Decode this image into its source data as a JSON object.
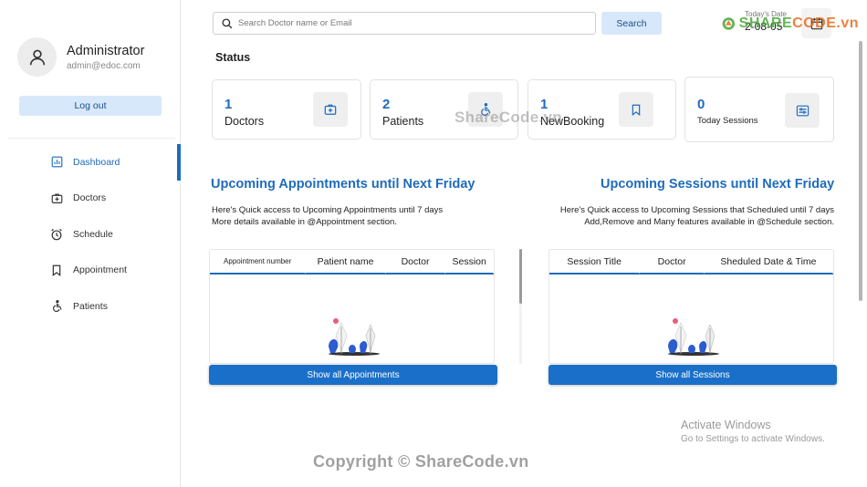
{
  "sidebar": {
    "admin_name": "Administrator",
    "admin_email": "admin@edoc.com",
    "logout_label": "Log out",
    "items": [
      {
        "label": "Dashboard",
        "icon": "dashboard-icon",
        "active": true
      },
      {
        "label": "Doctors",
        "icon": "doctor-icon",
        "active": false
      },
      {
        "label": "Schedule",
        "icon": "alarm-clock-icon",
        "active": false
      },
      {
        "label": "Appointment",
        "icon": "bookmark-icon",
        "active": false
      },
      {
        "label": "Patients",
        "icon": "wheelchair-icon",
        "active": false
      }
    ]
  },
  "header": {
    "search_placeholder": "Search Doctor name or Email",
    "search_button": "Search",
    "today_label": "Today's Date",
    "today_value": "2-08-05"
  },
  "status": {
    "title": "Status",
    "cards": [
      {
        "count": "1",
        "label": "Doctors",
        "icon": "doctor-icon"
      },
      {
        "count": "2",
        "label": "Patients",
        "icon": "wheelchair-icon"
      },
      {
        "count": "1",
        "label": "NewBooking",
        "icon": "bookmark-icon"
      },
      {
        "count": "0",
        "label": "Today Sessions",
        "icon": "session-icon"
      }
    ]
  },
  "appointments": {
    "title": "Upcoming Appointments until Next Friday",
    "desc_line1": "Here's Quick access to Upcoming Appointments until 7 days",
    "desc_line2": "More details available in @Appointment section.",
    "columns": [
      "Appointment number",
      "Patient name",
      "Doctor",
      "Session"
    ],
    "button": "Show all Appointments"
  },
  "sessions": {
    "title": "Upcoming Sessions until Next Friday",
    "desc_line1": "Here's Quick access to Upcoming Sessions that Scheduled until 7 days",
    "desc_line2": "Add,Remove and Many features available in @Schedule section.",
    "columns": [
      "Session Title",
      "Doctor",
      "Sheduled Date & Time"
    ],
    "button": "Show all Sessions"
  },
  "watermarks": {
    "logo_prefix": "SHARE",
    "logo_suffix": "CODE.vn",
    "center": "ShareCode.vn",
    "bottom": "Copyright © ShareCode.vn"
  },
  "activate": {
    "title": "Activate Windows",
    "subtitle": "Go to Settings to activate Windows."
  },
  "colors": {
    "accent": "#1e6bbd",
    "button_light": "#d8e8fb",
    "button_primary": "#1a6fc9"
  }
}
